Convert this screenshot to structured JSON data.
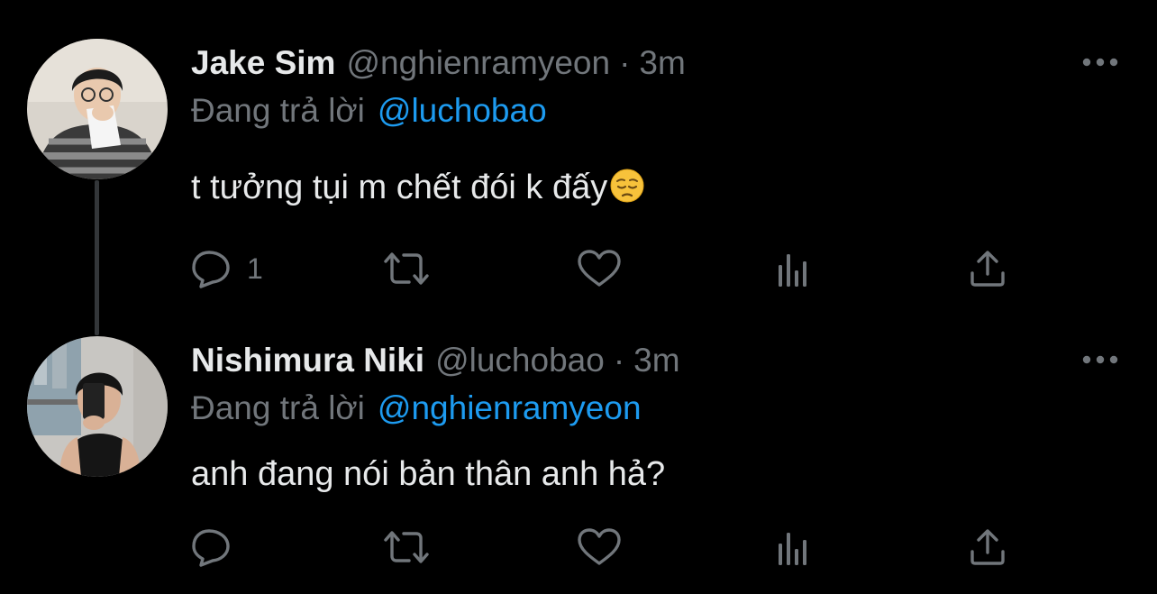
{
  "tweets": [
    {
      "display_name": "Jake Sim",
      "handle": "@nghienramyeon",
      "separator": "·",
      "time": "3m",
      "reply_prefix": "Đang trả lời",
      "reply_to": "@luchobao",
      "text": "t tưởng tụi m chết đói k đấy",
      "emoji": "pensive-face",
      "reply_count": "1"
    },
    {
      "display_name": "Nishimura Niki",
      "handle": "@luchobao",
      "separator": "·",
      "time": "3m",
      "reply_prefix": "Đang trả lời",
      "reply_to": "@nghienramyeon",
      "text": "anh đang nói bản thân anh hả?",
      "reply_count": ""
    }
  ],
  "icons": {
    "reply": "reply-icon",
    "retweet": "retweet-icon",
    "like": "heart-icon",
    "views": "analytics-icon",
    "share": "share-icon",
    "more": "more-dots-icon"
  },
  "colors": {
    "background": "#000000",
    "primary_text": "#e7e9ea",
    "secondary_text": "#71767b",
    "link": "#1d9bf0",
    "thread_line": "#333639"
  }
}
